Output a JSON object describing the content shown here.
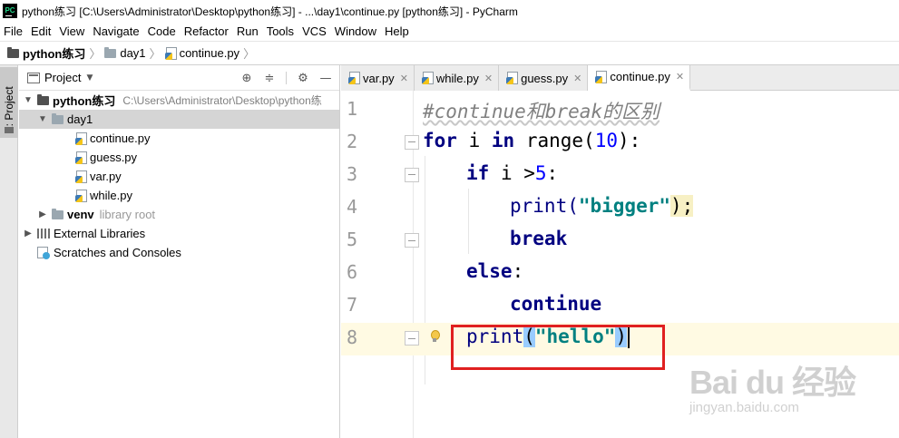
{
  "window": {
    "title": "python练习 [C:\\Users\\Administrator\\Desktop\\python练习] - ...\\day1\\continue.py [python练习] - PyCharm",
    "app_icon_text": "PC"
  },
  "menu": [
    "File",
    "Edit",
    "View",
    "Navigate",
    "Code",
    "Refactor",
    "Run",
    "Tools",
    "VCS",
    "Window",
    "Help"
  ],
  "breadcrumb": [
    "python练习",
    "day1",
    "continue.py"
  ],
  "left_stripe": {
    "label": "1: Project"
  },
  "project_panel": {
    "title": "Project",
    "tree": {
      "root": {
        "name": "python练习",
        "path": "C:\\Users\\Administrator\\Desktop\\python练"
      },
      "day1": "day1",
      "files": [
        "continue.py",
        "guess.py",
        "var.py",
        "while.py"
      ],
      "venv": {
        "name": "venv",
        "note": "library root"
      },
      "external_libraries": "External Libraries",
      "scratches": "Scratches and Consoles"
    }
  },
  "editor_tabs": [
    {
      "label": "var.py",
      "active": false
    },
    {
      "label": "while.py",
      "active": false
    },
    {
      "label": "guess.py",
      "active": false
    },
    {
      "label": "continue.py",
      "active": true
    }
  ],
  "code": {
    "line_numbers": [
      "1",
      "2",
      "3",
      "4",
      "5",
      "6",
      "7",
      "8"
    ],
    "line1": "#continue和break的区别",
    "line2": {
      "kw_for": "for",
      "var": " i ",
      "kw_in": "in",
      "fn": " range(",
      "num": "10",
      "end": "):"
    },
    "line3": {
      "kw": "if",
      "mid": " i >",
      "num": "5",
      "end": ":"
    },
    "line4": {
      "fn": "print(",
      "str": "\"bigger\"",
      "end": ");"
    },
    "line5": "break",
    "line6": {
      "kw": "else",
      "end": ":"
    },
    "line7": "continue",
    "line8": {
      "fn": "print",
      "open": "(",
      "str": "\"hello\"",
      "close": ")"
    }
  },
  "watermark": {
    "brand": "Bai du 经验",
    "url": "jingyan.baidu.com"
  }
}
